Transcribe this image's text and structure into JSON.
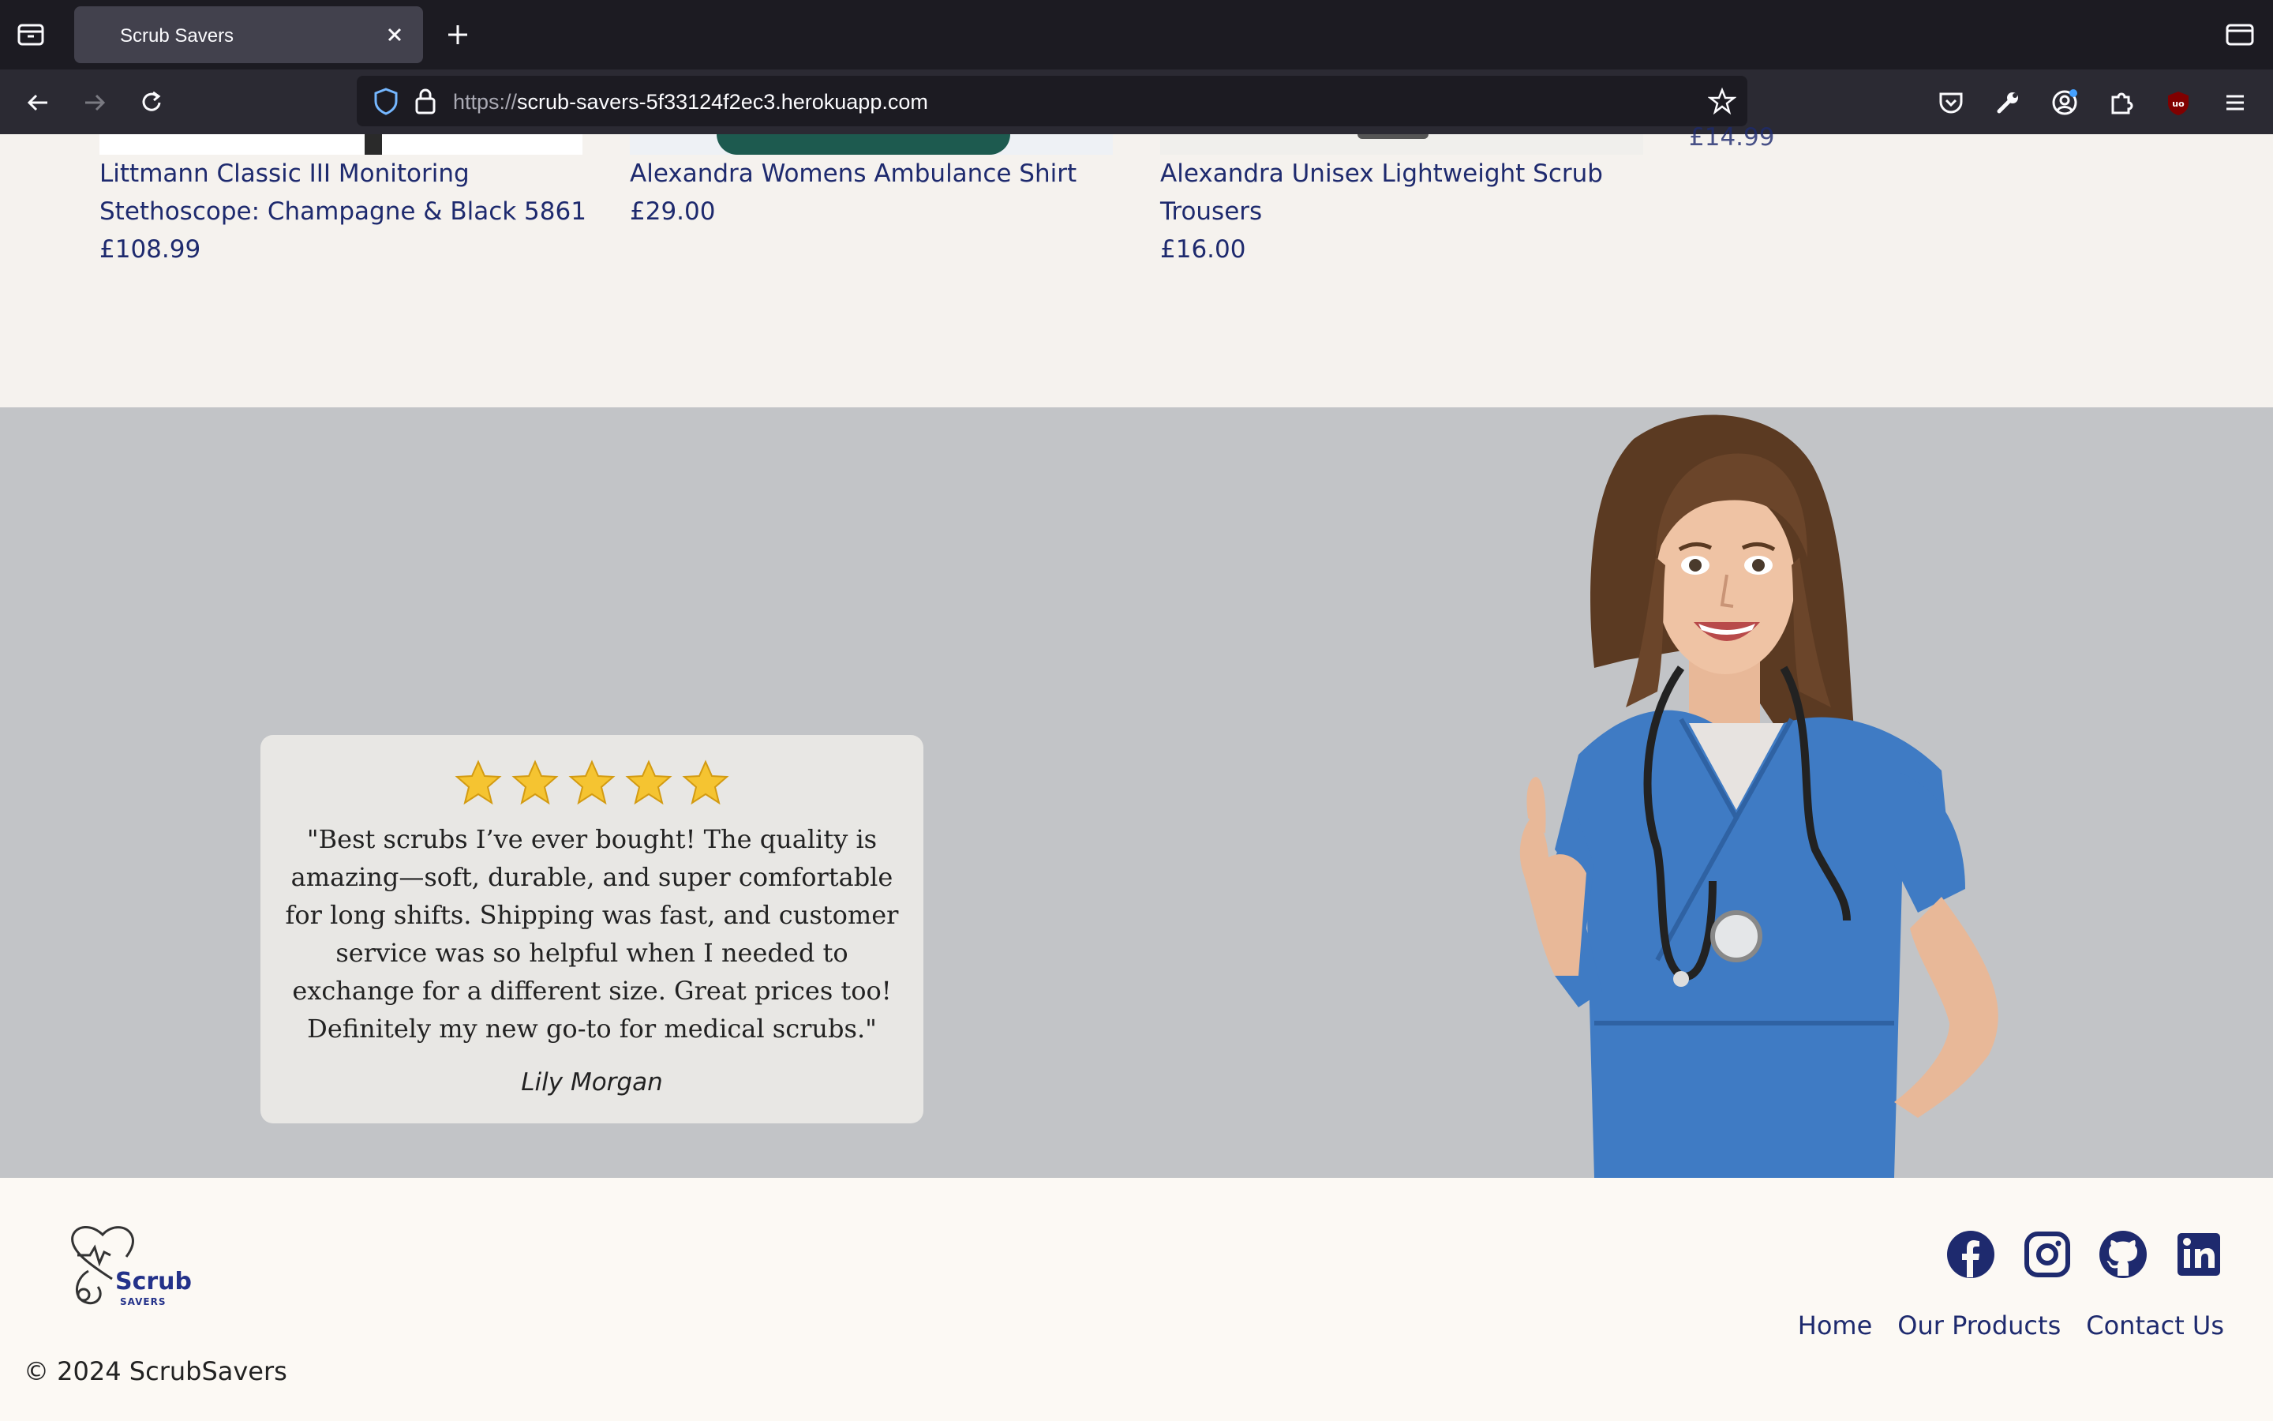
{
  "browser": {
    "tab_title": "Scrub Savers",
    "url_protocol": "https://",
    "url_host": "scrub-savers-5f33124f2ec3.herokuapp.com"
  },
  "products": [
    {
      "name": "Littmann Classic III Monitoring Stethoscope: Champagne & Black 5861",
      "price": "£108.99"
    },
    {
      "name": "Alexandra Womens Ambulance Shirt",
      "price": "£29.00"
    },
    {
      "name": "Alexandra Unisex Lightweight Scrub Trousers",
      "price": "£16.00"
    }
  ],
  "partial_price": "£14.99",
  "testimonial": {
    "rating": 5,
    "quote": "\"Best scrubs I’ve ever bought! The quality is amazing—soft, durable, and super comfortable for long shifts. Shipping was fast, and customer service was so helpful when I needed to exchange for a different size. Great prices too! Definitely my new go-to for medical scrubs.\"",
    "author": "Lily Morgan"
  },
  "footer": {
    "logo_text": "Scrub",
    "logo_sub": "SAVERS",
    "social": [
      "facebook-icon",
      "instagram-icon",
      "github-icon",
      "linkedin-icon"
    ],
    "links": [
      "Home",
      "Our Products",
      "Contact Us"
    ],
    "copyright": "© 2024 ScrubSavers"
  },
  "colors": {
    "brand_navy": "#1e2a6e",
    "testimonial_bg": "#c2c4c7",
    "footer_bg": "#fcf9f4",
    "scrub_blue": "#3f7bc4"
  }
}
